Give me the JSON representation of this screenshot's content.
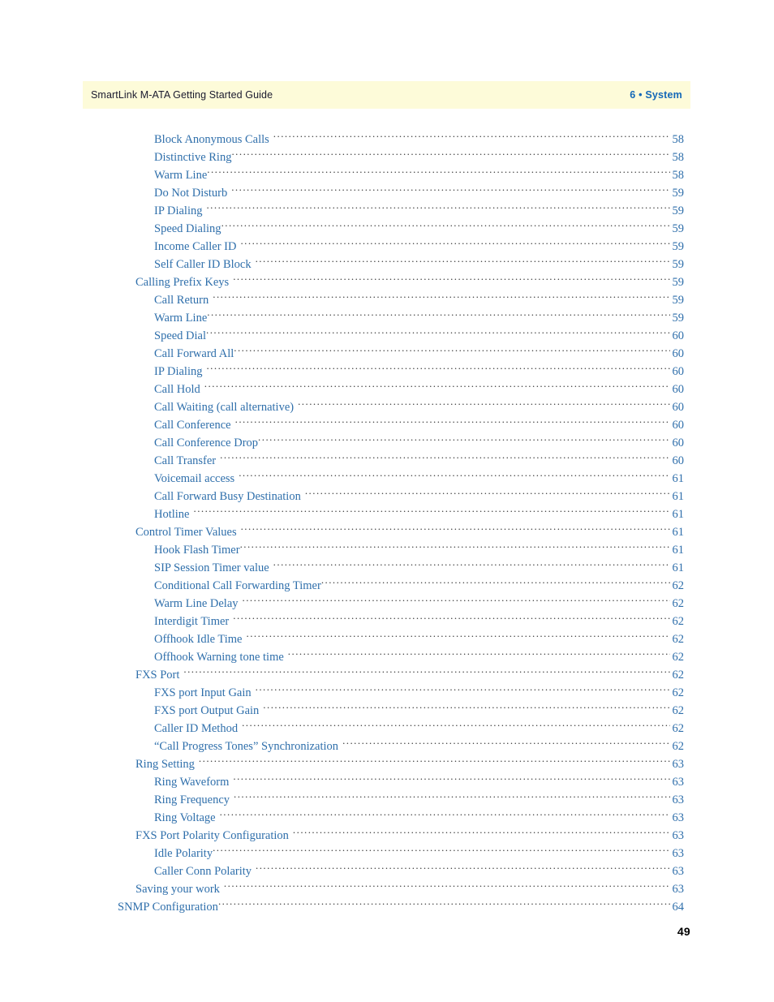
{
  "header": {
    "title": "SmartLink M-ATA Getting Started Guide",
    "chapter": "6 • System",
    "band_color": "#fdfbd9",
    "chapter_color": "#1368b8"
  },
  "folio": {
    "page_number": "49"
  },
  "toc": {
    "link_color": "#2f6fab",
    "leader_char": ".",
    "entries": [
      {
        "label": "Block Anonymous Calls",
        "page": "58",
        "level": 2,
        "gap": true
      },
      {
        "label": "Distinctive Ring",
        "page": "58",
        "level": 2,
        "gap": false
      },
      {
        "label": "Warm Line",
        "page": "58",
        "level": 2,
        "gap": false
      },
      {
        "label": "Do Not Disturb",
        "page": "59",
        "level": 2,
        "gap": true
      },
      {
        "label": "IP Dialing",
        "page": "59",
        "level": 2,
        "gap": true
      },
      {
        "label": "Speed Dialing",
        "page": "59",
        "level": 2,
        "gap": false
      },
      {
        "label": "Income Caller ID",
        "page": "59",
        "level": 2,
        "gap": true
      },
      {
        "label": "Self Caller ID Block",
        "page": "59",
        "level": 2,
        "gap": true
      },
      {
        "label": "Calling Prefix Keys",
        "page": "59",
        "level": 1,
        "gap": true
      },
      {
        "label": "Call Return",
        "page": "59",
        "level": 2,
        "gap": true
      },
      {
        "label": "Warm Line",
        "page": "59",
        "level": 2,
        "gap": false
      },
      {
        "label": "Speed Dial",
        "page": "60",
        "level": 2,
        "gap": false
      },
      {
        "label": "Call Forward All",
        "page": "60",
        "level": 2,
        "gap": false
      },
      {
        "label": "IP Dialing",
        "page": "60",
        "level": 2,
        "gap": true
      },
      {
        "label": "Call Hold",
        "page": "60",
        "level": 2,
        "gap": true
      },
      {
        "label": "Call Waiting (call alternative)",
        "page": "60",
        "level": 2,
        "gap": true
      },
      {
        "label": "Call Conference",
        "page": "60",
        "level": 2,
        "gap": true
      },
      {
        "label": "Call Conference Drop",
        "page": "60",
        "level": 2,
        "gap": false
      },
      {
        "label": "Call Transfer",
        "page": "60",
        "level": 2,
        "gap": true
      },
      {
        "label": "Voicemail access",
        "page": "61",
        "level": 2,
        "gap": true
      },
      {
        "label": "Call Forward Busy Destination",
        "page": "61",
        "level": 2,
        "gap": true
      },
      {
        "label": "Hotline",
        "page": "61",
        "level": 2,
        "gap": true
      },
      {
        "label": "Control Timer Values",
        "page": "61",
        "level": 1,
        "gap": true
      },
      {
        "label": "Hook Flash Timer",
        "page": "61",
        "level": 2,
        "gap": false
      },
      {
        "label": "SIP Session Timer value",
        "page": "61",
        "level": 2,
        "gap": true
      },
      {
        "label": "Conditional Call Forwarding Timer",
        "page": "62",
        "level": 2,
        "gap": false
      },
      {
        "label": "Warm Line Delay",
        "page": "62",
        "level": 2,
        "gap": true
      },
      {
        "label": "Interdigit Timer",
        "page": "62",
        "level": 2,
        "gap": true
      },
      {
        "label": "Offhook Idle Time",
        "page": "62",
        "level": 2,
        "gap": true
      },
      {
        "label": "Offhook Warning tone time",
        "page": "62",
        "level": 2,
        "gap": true
      },
      {
        "label": "FXS Port",
        "page": "62",
        "level": 1,
        "gap": true
      },
      {
        "label": "FXS port Input Gain",
        "page": "62",
        "level": 2,
        "gap": true
      },
      {
        "label": "FXS port Output Gain",
        "page": "62",
        "level": 2,
        "gap": true
      },
      {
        "label": "Caller ID Method",
        "page": "62",
        "level": 2,
        "gap": true
      },
      {
        "label": "“Call Progress Tones” Synchronization",
        "page": "62",
        "level": 2,
        "gap": true
      },
      {
        "label": "Ring Setting",
        "page": "63",
        "level": 1,
        "gap": true
      },
      {
        "label": "Ring Waveform",
        "page": "63",
        "level": 2,
        "gap": true
      },
      {
        "label": "Ring Frequency",
        "page": "63",
        "level": 2,
        "gap": true
      },
      {
        "label": "Ring Voltage",
        "page": "63",
        "level": 2,
        "gap": true
      },
      {
        "label": "FXS Port Polarity Configuration",
        "page": "63",
        "level": 1,
        "gap": true
      },
      {
        "label": "Idle Polarity",
        "page": "63",
        "level": 2,
        "gap": false
      },
      {
        "label": "Caller Conn Polarity",
        "page": "63",
        "level": 2,
        "gap": true
      },
      {
        "label": "Saving your work",
        "page": "63",
        "level": 1,
        "gap": true
      },
      {
        "label": "SNMP Configuration",
        "page": "64",
        "level": 0,
        "gap": false
      }
    ]
  }
}
